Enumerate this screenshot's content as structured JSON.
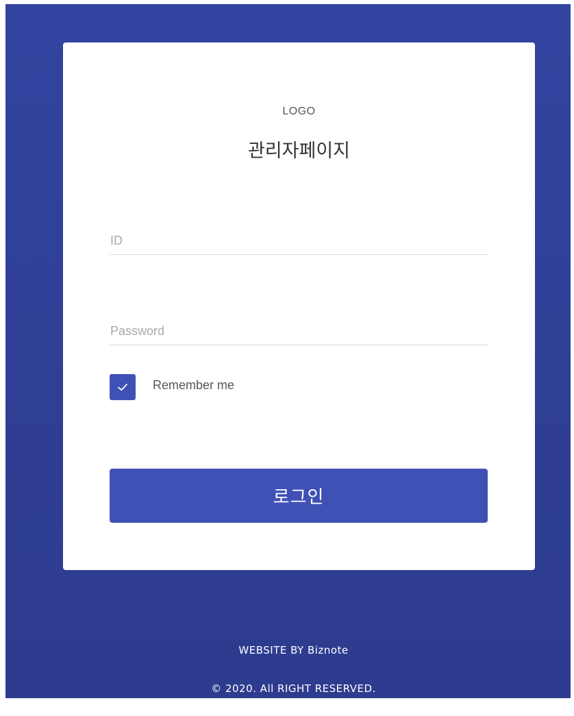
{
  "colors": {
    "background": "#3244a0",
    "card": "#ffffff",
    "accent": "#3f51b5",
    "text": "#333333",
    "placeholder": "#a8a8a8"
  },
  "header": {
    "logo_text": "LOGO",
    "title": "관리자페이지"
  },
  "form": {
    "id_placeholder": "ID",
    "id_value": "",
    "password_placeholder": "Password",
    "password_value": "",
    "remember_label": "Remember me",
    "remember_checked": true,
    "login_label": "로그인"
  },
  "icons": {
    "checkbox": "check-icon"
  },
  "footer": {
    "credit": "WEBSITE BY Biznote",
    "copyright": "© 2020. All RIGHT RESERVED."
  }
}
